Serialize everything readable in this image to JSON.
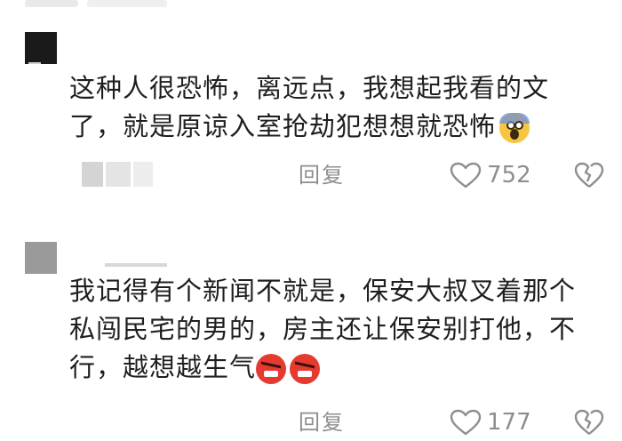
{
  "comments": [
    {
      "lines": [
        "这种人很恐怖，离远点，我想起我看的文",
        "了，就是原谅入室抢劫犯想想就恐怖"
      ],
      "emoji": "scared-face-icon",
      "reply_label": "回复",
      "likes": "752"
    },
    {
      "lines": [
        "我记得有个新闻不就是，保安大叔叉着那个",
        "私闯民宅的男的，房主还让保安别打他，不",
        "行，越想越生气"
      ],
      "emoji": "angry-face-icon",
      "reply_label": "回复",
      "likes": "177"
    }
  ],
  "colors": {
    "text": "#1f1f1f",
    "meta": "#8e8e8e",
    "angry_emoji": "#e43a30",
    "scared_emoji": "#f6c543"
  }
}
